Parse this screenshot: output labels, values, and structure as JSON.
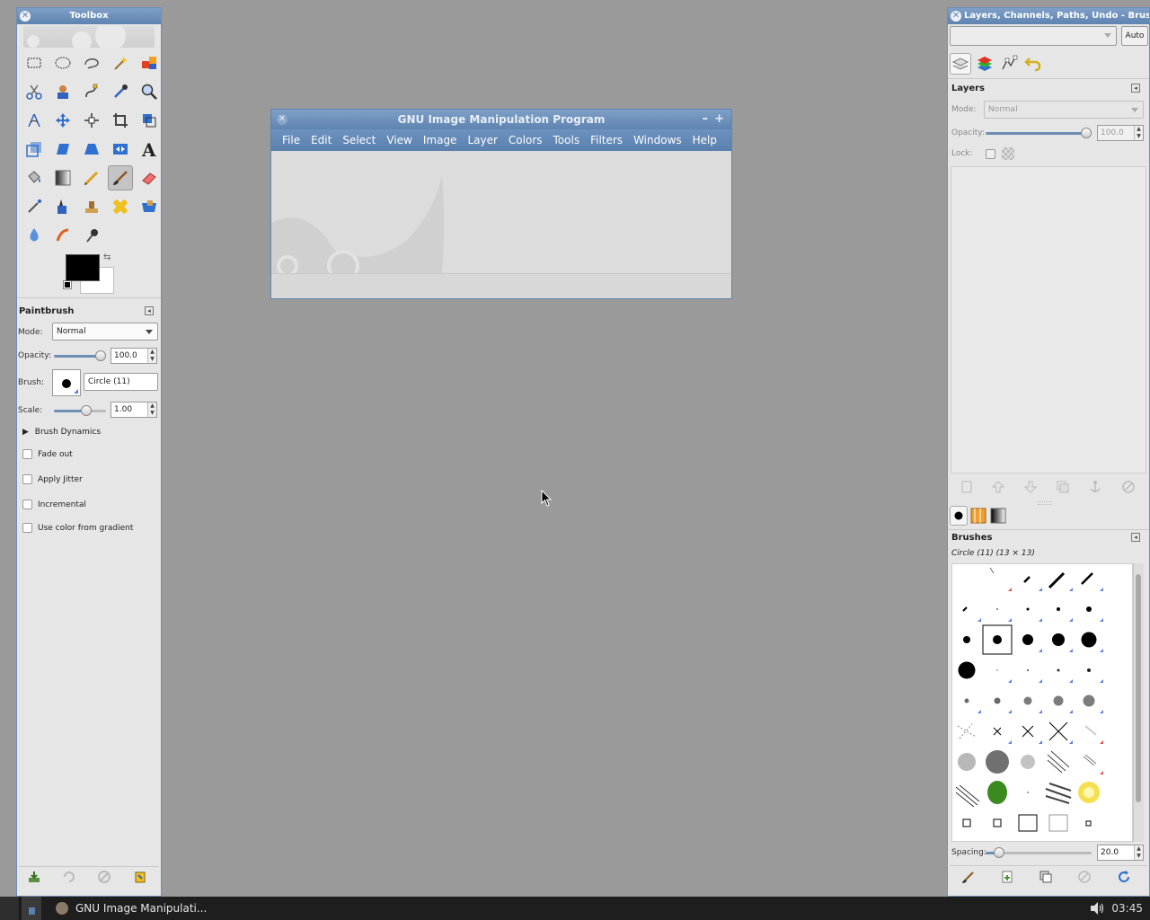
{
  "toolbox": {
    "title": "Toolbox",
    "tools": [
      "rect-select",
      "ellipse-select",
      "free-select",
      "fuzzy-select",
      "select-by-color",
      "scissors-select",
      "foreground-select",
      "paths",
      "color-picker",
      "zoom",
      "measure",
      "move",
      "align",
      "crop",
      "rotate",
      "scale",
      "shear",
      "perspective",
      "flip",
      "text",
      "bucket-fill",
      "blend",
      "pencil",
      "paintbrush",
      "eraser",
      "airbrush",
      "ink",
      "clone",
      "heal",
      "perspective-clone",
      "blur-sharpen",
      "smudge",
      "dodge-burn"
    ],
    "active_tool": "paintbrush"
  },
  "tool_options": {
    "title": "Paintbrush",
    "mode_label": "Mode:",
    "mode_value": "Normal",
    "opacity_label": "Opacity:",
    "opacity_value": "100.0",
    "opacity_level": 1.0,
    "brush_label": "Brush:",
    "brush_value": "Circle (11)",
    "scale_label": "Scale:",
    "scale_value": "1.00",
    "scale_level": 0.6,
    "brush_dynamics": "Brush Dynamics",
    "checks": [
      "Fade out",
      "Apply Jitter",
      "Incremental",
      "Use color from gradient"
    ]
  },
  "main_window": {
    "title": "GNU Image Manipulation Program",
    "menu": [
      "File",
      "Edit",
      "Select",
      "View",
      "Image",
      "Layer",
      "Colors",
      "Tools",
      "Filters",
      "Windows",
      "Help"
    ]
  },
  "dock": {
    "title": "Layers, Channels, Paths, Undo - Brushes, I",
    "auto_button": "Auto",
    "layers_title": "Layers",
    "mode_label": "Mode:",
    "mode_value": "Normal",
    "opacity_label": "Opacity:",
    "opacity_value": "100.0",
    "lock_label": "Lock:",
    "brushes_title": "Brushes",
    "brush_info": "Circle (11) (13 × 13)",
    "spacing_label": "Spacing:",
    "spacing_value": "20.0",
    "spacing_level": 0.2
  },
  "taskbar": {
    "app_label": "GNU Image Manipulati...",
    "clock": "03:45"
  },
  "colors": {
    "titlebar": "#5f84b1",
    "desktop": "#9a9a9a",
    "foreground": "#000000",
    "background": "#ffffff"
  }
}
